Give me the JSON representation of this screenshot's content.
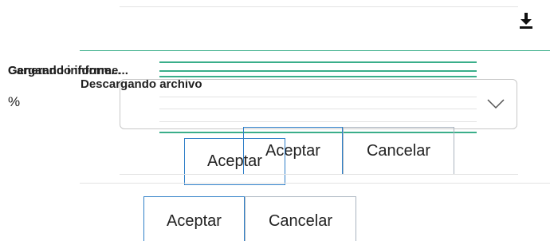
{
  "header": {
    "download_icon": "download-icon"
  },
  "loading": {
    "label_cargando": "Cargando informe...",
    "label_generando": "Generando informe...",
    "label_descargando": "Descargando archivo",
    "percent": "%"
  },
  "select": {
    "icon": "chevron-down-icon",
    "value": ""
  },
  "dialog_upper": {
    "accept_label": "Aceptar",
    "cancel_label": "Cancelar"
  },
  "dialog_floating": {
    "accept_label": "Aceptar"
  },
  "dialog_lower": {
    "accept_label": "Aceptar",
    "cancel_label": "Cancelar"
  },
  "colors": {
    "accent_green": "#3aae8a",
    "primary_border": "#2f7fc8",
    "secondary_border": "#aab4bf",
    "divider": "#e3e3e3"
  }
}
